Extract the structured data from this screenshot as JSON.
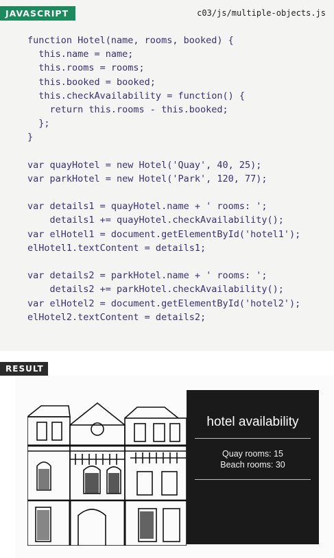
{
  "header": {
    "language_label": "JAVASCRIPT",
    "file_path": "c03/js/multiple-objects.js"
  },
  "code_lines": [
    "function Hotel(name, rooms, booked) {",
    "  this.name = name;",
    "  this.rooms = rooms;",
    "  this.booked = booked;",
    "  this.checkAvailability = function() {",
    "    return this.rooms - this.booked;",
    "  };",
    "}",
    "",
    "var quayHotel = new Hotel('Quay', 40, 25);",
    "var parkHotel = new Hotel('Park', 120, 77);",
    "",
    "var details1 = quayHotel.name + ' rooms: ';",
    "    details1 += quayHotel.checkAvailability();",
    "var elHotel1 = document.getElementById('hotel1');",
    "elHotel1.textContent = details1;",
    "",
    "var details2 = parkHotel.name + ' rooms: ';",
    "    details2 += parkHotel.checkAvailability();",
    "var elHotel2 = document.getElementById('hotel2');",
    "elHotel2.textContent = details2;"
  ],
  "result": {
    "label": "RESULT",
    "panel_title": "hotel availability",
    "rooms": [
      "Quay rooms: 15",
      "Beach rooms: 30"
    ]
  },
  "colors": {
    "javascript_tag": "#1d8a5e",
    "result_tag": "#2b2b2b",
    "code_text": "#3b2f7a",
    "panel_background": "#1a1a1a"
  },
  "icons": {
    "illustration": "victorian-hotel-building-sketch"
  }
}
